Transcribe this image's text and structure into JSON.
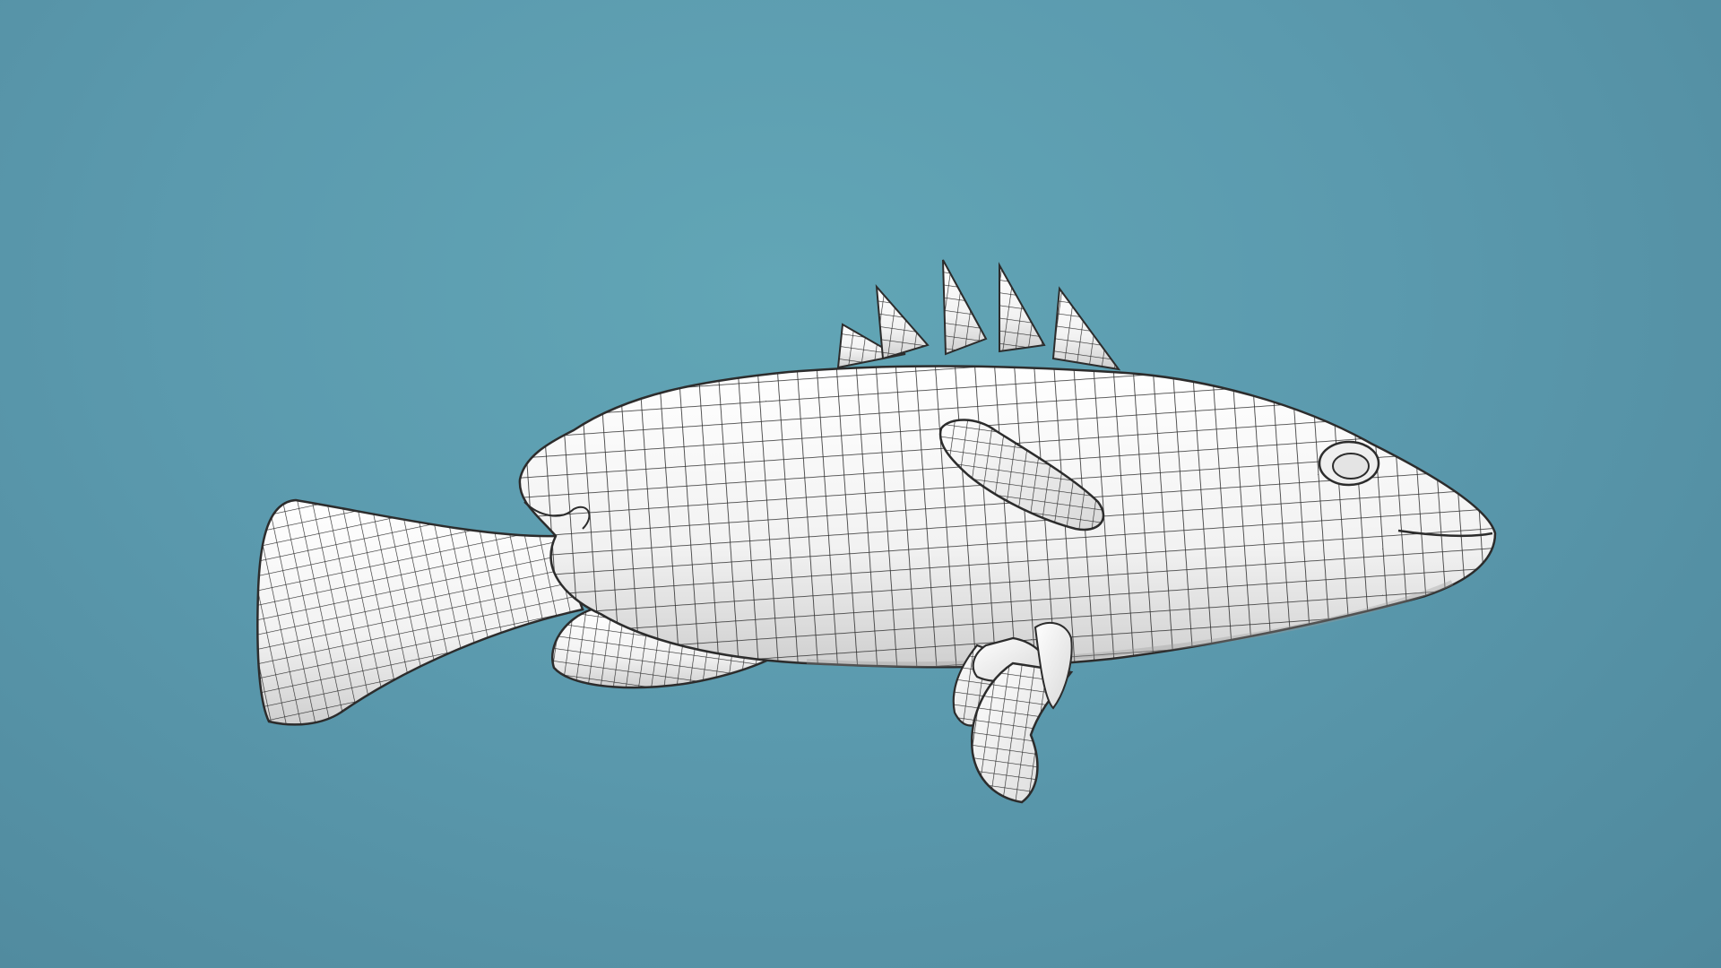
{
  "scene": {
    "background_color": "#5b9aae",
    "mesh_fill_color": "#f4f4f4",
    "wire_color": "#2c2c2c",
    "subject": "fish-wireframe-model"
  }
}
